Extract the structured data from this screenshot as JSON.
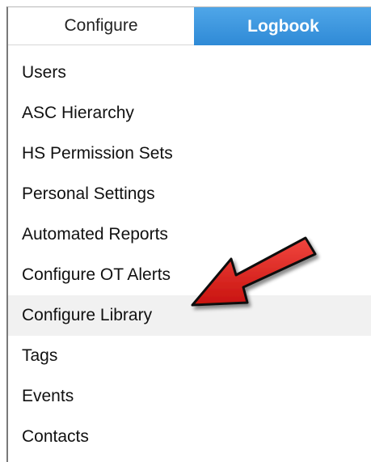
{
  "tabs": [
    {
      "label": "Configure",
      "active": true
    },
    {
      "label": "Logbook",
      "active": false
    }
  ],
  "menu": {
    "items": [
      {
        "label": "Users"
      },
      {
        "label": "ASC Hierarchy"
      },
      {
        "label": "HS Permission Sets"
      },
      {
        "label": "Personal Settings"
      },
      {
        "label": "Automated Reports"
      },
      {
        "label": "Configure OT Alerts"
      },
      {
        "label": "Configure Library",
        "highlighted": true
      },
      {
        "label": "Tags"
      },
      {
        "label": "Events"
      },
      {
        "label": "Contacts"
      }
    ]
  },
  "colors": {
    "active_tab_bg": "#3a95dd",
    "highlight_row": "#f1f1f1",
    "arrow": "#e0231f"
  },
  "annotation": {
    "icon": "red-arrow-icon",
    "points_to": "Configure Library"
  }
}
